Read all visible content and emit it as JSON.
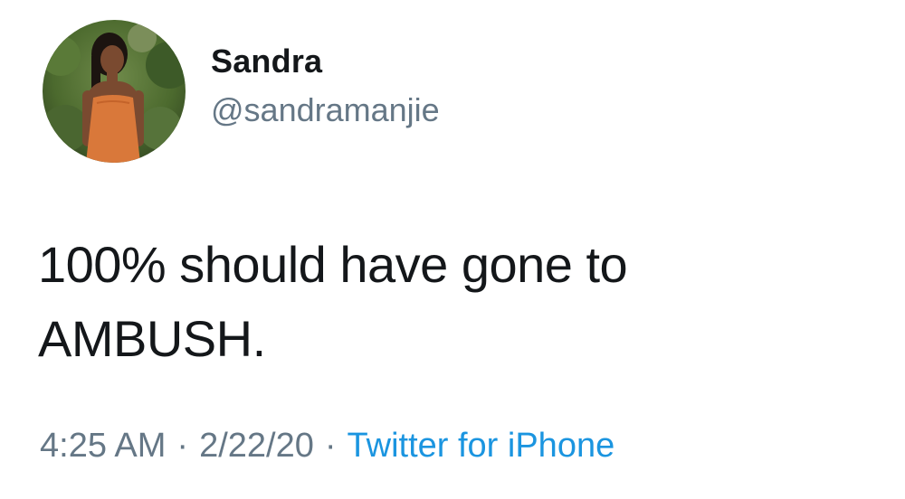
{
  "author": {
    "display_name": "Sandra",
    "handle": "@sandramanjie"
  },
  "tweet": {
    "text_line1": "100% should have gone to",
    "text_line2": "AMBUSH."
  },
  "meta": {
    "time": "4:25 AM",
    "separator": "·",
    "date": "2/22/20",
    "source": "Twitter for iPhone"
  },
  "colors": {
    "text": "#14171a",
    "secondary": "#657786",
    "link": "#1b95e0"
  }
}
